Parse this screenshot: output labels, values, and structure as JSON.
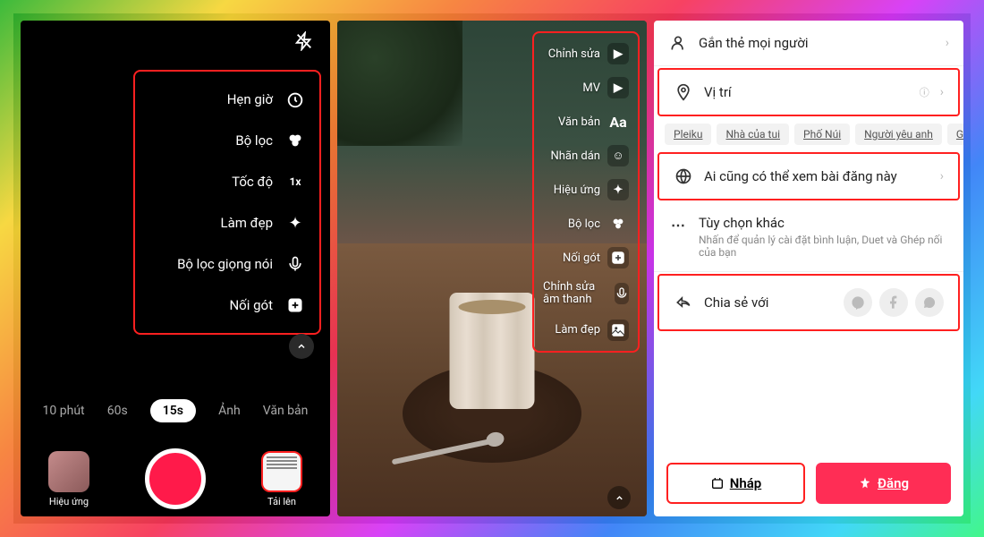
{
  "panel1": {
    "tools": [
      {
        "label": "Hẹn giờ",
        "icon": "⏱"
      },
      {
        "label": "Bộ lọc",
        "icon": "◉"
      },
      {
        "label": "Tốc độ",
        "icon": "1x"
      },
      {
        "label": "Làm đẹp",
        "icon": "✦"
      },
      {
        "label": "Bộ lọc giọng nói",
        "icon": "🎤"
      },
      {
        "label": "Nối gót",
        "icon": "⊕"
      }
    ],
    "durations": [
      "10 phút",
      "60s",
      "15s",
      "Ảnh",
      "Văn bản"
    ],
    "active_duration": "15s",
    "effects_label": "Hiệu ứng",
    "upload_label": "Tải lên"
  },
  "panel2": {
    "tools": [
      {
        "label": "Chỉnh sửa",
        "icon": "▶"
      },
      {
        "label": "MV",
        "icon": "▶"
      },
      {
        "label": "Văn bản",
        "icon": "Aa"
      },
      {
        "label": "Nhãn dán",
        "icon": "☺"
      },
      {
        "label": "Hiệu ứng",
        "icon": "✦"
      },
      {
        "label": "Bộ lọc",
        "icon": "◉"
      },
      {
        "label": "Nối gót",
        "icon": "⊕"
      },
      {
        "label": "Chỉnh sửa âm thanh",
        "icon": "🎤"
      },
      {
        "label": "Làm đẹp",
        "icon": "🖼"
      }
    ]
  },
  "panel3": {
    "tag_people": "Gắn thẻ mọi người",
    "location": "Vị trí",
    "location_chips": [
      "Pleiku",
      "Nhà của tui",
      "Phố Núi",
      "Người yêu anh",
      "Gia Lai"
    ],
    "privacy": "Ai cũng có thể xem bài đăng này",
    "more_title": "Tùy chọn khác",
    "more_sub": "Nhấn để quản lý cài đặt bình luận, Duet và Ghép nối của bạn",
    "share_label": "Chia sẻ với",
    "draft_label": "Nháp",
    "post_label": "Đăng"
  }
}
